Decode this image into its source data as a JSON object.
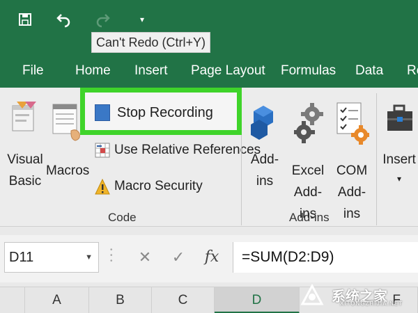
{
  "quick_access": {
    "save_icon": "save-icon",
    "undo_icon": "undo-icon",
    "redo_icon": "redo-icon",
    "customize_icon": "caret-down-icon",
    "tooltip": "Can't Redo (Ctrl+Y)"
  },
  "tabs": [
    "File",
    "Home",
    "Insert",
    "Page Layout",
    "Formulas",
    "Data",
    "Re"
  ],
  "ribbon": {
    "code_group": {
      "visual_basic": "Visual\nBasic",
      "macros": "Macros",
      "stop_recording": "Stop Recording",
      "use_relative_references": "Use Relative References",
      "macro_security": "Macro Security",
      "label": "Code"
    },
    "addins_group": {
      "addins": "Add-\nins",
      "excel_addins": "Excel\nAdd-ins",
      "com_addins": "COM\nAdd-ins",
      "label": "Add-ins"
    },
    "insert": "Insert",
    "insert_arrow": "▾"
  },
  "formula_bar": {
    "name_box": "D11",
    "cancel_symbol": "✕",
    "enter_symbol": "✓",
    "fx_symbol": "fx",
    "formula": "=SUM(D2:D9)"
  },
  "columns": [
    "A",
    "B",
    "C",
    "D",
    "F"
  ],
  "active_column": "D",
  "watermark": {
    "text": "系统之家",
    "sub": "XITONGZHIJIA.NET"
  },
  "colors": {
    "excel_green": "#217346",
    "highlight_green": "#3fd42a",
    "stop_blue": "#3a78c6"
  }
}
